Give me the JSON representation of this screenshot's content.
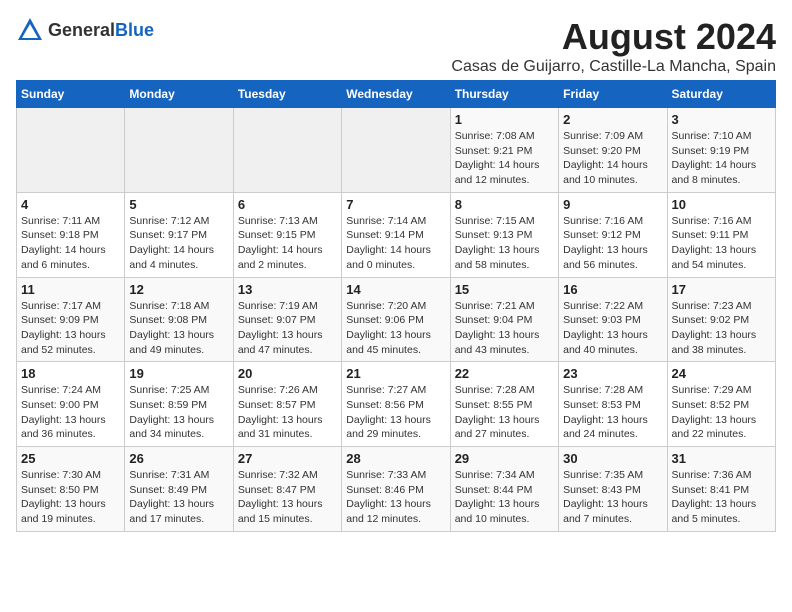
{
  "header": {
    "logo_general": "General",
    "logo_blue": "Blue",
    "month_title": "August 2024",
    "location": "Casas de Guijarro, Castille-La Mancha, Spain"
  },
  "days_of_week": [
    "Sunday",
    "Monday",
    "Tuesday",
    "Wednesday",
    "Thursday",
    "Friday",
    "Saturday"
  ],
  "weeks": [
    [
      {
        "day": "",
        "detail": ""
      },
      {
        "day": "",
        "detail": ""
      },
      {
        "day": "",
        "detail": ""
      },
      {
        "day": "",
        "detail": ""
      },
      {
        "day": "1",
        "detail": "Sunrise: 7:08 AM\nSunset: 9:21 PM\nDaylight: 14 hours\nand 12 minutes."
      },
      {
        "day": "2",
        "detail": "Sunrise: 7:09 AM\nSunset: 9:20 PM\nDaylight: 14 hours\nand 10 minutes."
      },
      {
        "day": "3",
        "detail": "Sunrise: 7:10 AM\nSunset: 9:19 PM\nDaylight: 14 hours\nand 8 minutes."
      }
    ],
    [
      {
        "day": "4",
        "detail": "Sunrise: 7:11 AM\nSunset: 9:18 PM\nDaylight: 14 hours\nand 6 minutes."
      },
      {
        "day": "5",
        "detail": "Sunrise: 7:12 AM\nSunset: 9:17 PM\nDaylight: 14 hours\nand 4 minutes."
      },
      {
        "day": "6",
        "detail": "Sunrise: 7:13 AM\nSunset: 9:15 PM\nDaylight: 14 hours\nand 2 minutes."
      },
      {
        "day": "7",
        "detail": "Sunrise: 7:14 AM\nSunset: 9:14 PM\nDaylight: 14 hours\nand 0 minutes."
      },
      {
        "day": "8",
        "detail": "Sunrise: 7:15 AM\nSunset: 9:13 PM\nDaylight: 13 hours\nand 58 minutes."
      },
      {
        "day": "9",
        "detail": "Sunrise: 7:16 AM\nSunset: 9:12 PM\nDaylight: 13 hours\nand 56 minutes."
      },
      {
        "day": "10",
        "detail": "Sunrise: 7:16 AM\nSunset: 9:11 PM\nDaylight: 13 hours\nand 54 minutes."
      }
    ],
    [
      {
        "day": "11",
        "detail": "Sunrise: 7:17 AM\nSunset: 9:09 PM\nDaylight: 13 hours\nand 52 minutes."
      },
      {
        "day": "12",
        "detail": "Sunrise: 7:18 AM\nSunset: 9:08 PM\nDaylight: 13 hours\nand 49 minutes."
      },
      {
        "day": "13",
        "detail": "Sunrise: 7:19 AM\nSunset: 9:07 PM\nDaylight: 13 hours\nand 47 minutes."
      },
      {
        "day": "14",
        "detail": "Sunrise: 7:20 AM\nSunset: 9:06 PM\nDaylight: 13 hours\nand 45 minutes."
      },
      {
        "day": "15",
        "detail": "Sunrise: 7:21 AM\nSunset: 9:04 PM\nDaylight: 13 hours\nand 43 minutes."
      },
      {
        "day": "16",
        "detail": "Sunrise: 7:22 AM\nSunset: 9:03 PM\nDaylight: 13 hours\nand 40 minutes."
      },
      {
        "day": "17",
        "detail": "Sunrise: 7:23 AM\nSunset: 9:02 PM\nDaylight: 13 hours\nand 38 minutes."
      }
    ],
    [
      {
        "day": "18",
        "detail": "Sunrise: 7:24 AM\nSunset: 9:00 PM\nDaylight: 13 hours\nand 36 minutes."
      },
      {
        "day": "19",
        "detail": "Sunrise: 7:25 AM\nSunset: 8:59 PM\nDaylight: 13 hours\nand 34 minutes."
      },
      {
        "day": "20",
        "detail": "Sunrise: 7:26 AM\nSunset: 8:57 PM\nDaylight: 13 hours\nand 31 minutes."
      },
      {
        "day": "21",
        "detail": "Sunrise: 7:27 AM\nSunset: 8:56 PM\nDaylight: 13 hours\nand 29 minutes."
      },
      {
        "day": "22",
        "detail": "Sunrise: 7:28 AM\nSunset: 8:55 PM\nDaylight: 13 hours\nand 27 minutes."
      },
      {
        "day": "23",
        "detail": "Sunrise: 7:28 AM\nSunset: 8:53 PM\nDaylight: 13 hours\nand 24 minutes."
      },
      {
        "day": "24",
        "detail": "Sunrise: 7:29 AM\nSunset: 8:52 PM\nDaylight: 13 hours\nand 22 minutes."
      }
    ],
    [
      {
        "day": "25",
        "detail": "Sunrise: 7:30 AM\nSunset: 8:50 PM\nDaylight: 13 hours\nand 19 minutes."
      },
      {
        "day": "26",
        "detail": "Sunrise: 7:31 AM\nSunset: 8:49 PM\nDaylight: 13 hours\nand 17 minutes."
      },
      {
        "day": "27",
        "detail": "Sunrise: 7:32 AM\nSunset: 8:47 PM\nDaylight: 13 hours\nand 15 minutes."
      },
      {
        "day": "28",
        "detail": "Sunrise: 7:33 AM\nSunset: 8:46 PM\nDaylight: 13 hours\nand 12 minutes."
      },
      {
        "day": "29",
        "detail": "Sunrise: 7:34 AM\nSunset: 8:44 PM\nDaylight: 13 hours\nand 10 minutes."
      },
      {
        "day": "30",
        "detail": "Sunrise: 7:35 AM\nSunset: 8:43 PM\nDaylight: 13 hours\nand 7 minutes."
      },
      {
        "day": "31",
        "detail": "Sunrise: 7:36 AM\nSunset: 8:41 PM\nDaylight: 13 hours\nand 5 minutes."
      }
    ]
  ]
}
